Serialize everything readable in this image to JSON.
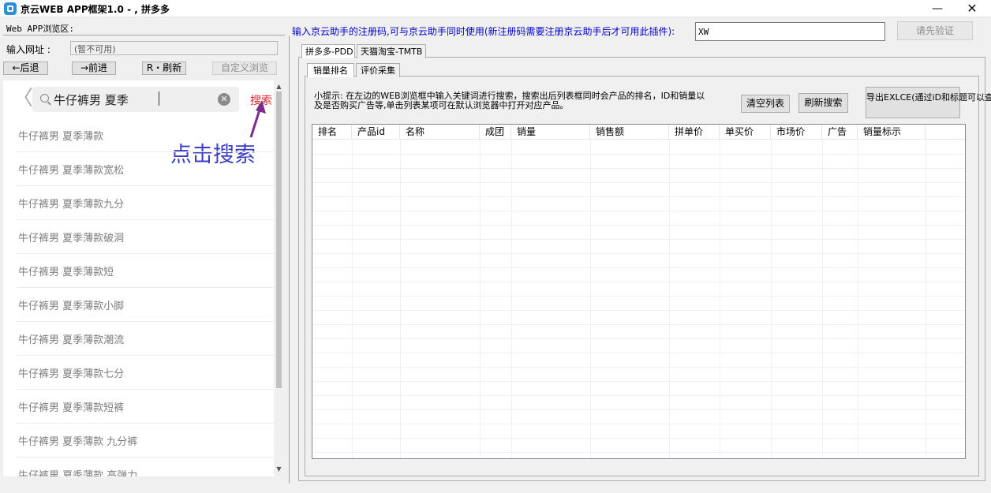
{
  "window": {
    "title": "京云WEB APP框架1.0 - , 拼多多",
    "minimize_glyph": "—",
    "close_glyph": "✕"
  },
  "left": {
    "web_area_label": "Web APP浏览区:",
    "url_label": "输入网址 :",
    "url_value": "(暂不可用)",
    "back_btn": "←后退",
    "forward_btn": "→前进",
    "refresh_btn": "R・刷新",
    "custom_btn": "自定义浏览"
  },
  "phone": {
    "back_glyph": "〈",
    "search_text": "牛仔裤男 夏季",
    "clear_glyph": "✕",
    "search_button": "搜索",
    "annotation": "点击搜索",
    "suggestions": [
      "牛仔裤男 夏季薄款",
      "牛仔裤男 夏季薄款宽松",
      "牛仔裤男 夏季薄款九分",
      "牛仔裤男 夏季薄款破洞",
      "牛仔裤男 夏季薄款短",
      "牛仔裤男 夏季薄款小脚",
      "牛仔裤男 夏季薄款潮流",
      "牛仔裤男 夏季薄款七分",
      "牛仔裤男 夏季薄款短裤",
      "牛仔裤男 夏季薄款 九分裤",
      "牛仔裤男 夏季薄款 高弹力"
    ],
    "scroll_up": "▲",
    "scroll_down": "▼"
  },
  "right": {
    "reg_hint": "输入京云助手的注册码,可与京云助手同时使用(新注册码需要注册京云助手后才可用此插件):",
    "reg_value": "XW",
    "verify_btn": "请先验证",
    "tabs": [
      "拼多多-PDD",
      "天猫淘宝-TMTB"
    ],
    "subtabs": [
      "销量排名",
      "评价采集"
    ],
    "tips": "小提示: 在左边的WEB浏览框中输入关键词进行搜索，搜索出后列表框同时会产品的排名，ID和销量以及是否购买广告等,单击列表某项可在默认浏览器中打开对应产品。",
    "clear_list_btn": "清空列表",
    "refresh_search_btn": "刷新搜索",
    "export_btn": "导出EXLCE(通过iD和标题可以查找排名)",
    "columns": [
      "排名",
      "产品id",
      "名称",
      "成团",
      "销量",
      "销售额",
      "拼单价",
      "单买价",
      "市场价",
      "广告",
      "销量标示"
    ]
  }
}
